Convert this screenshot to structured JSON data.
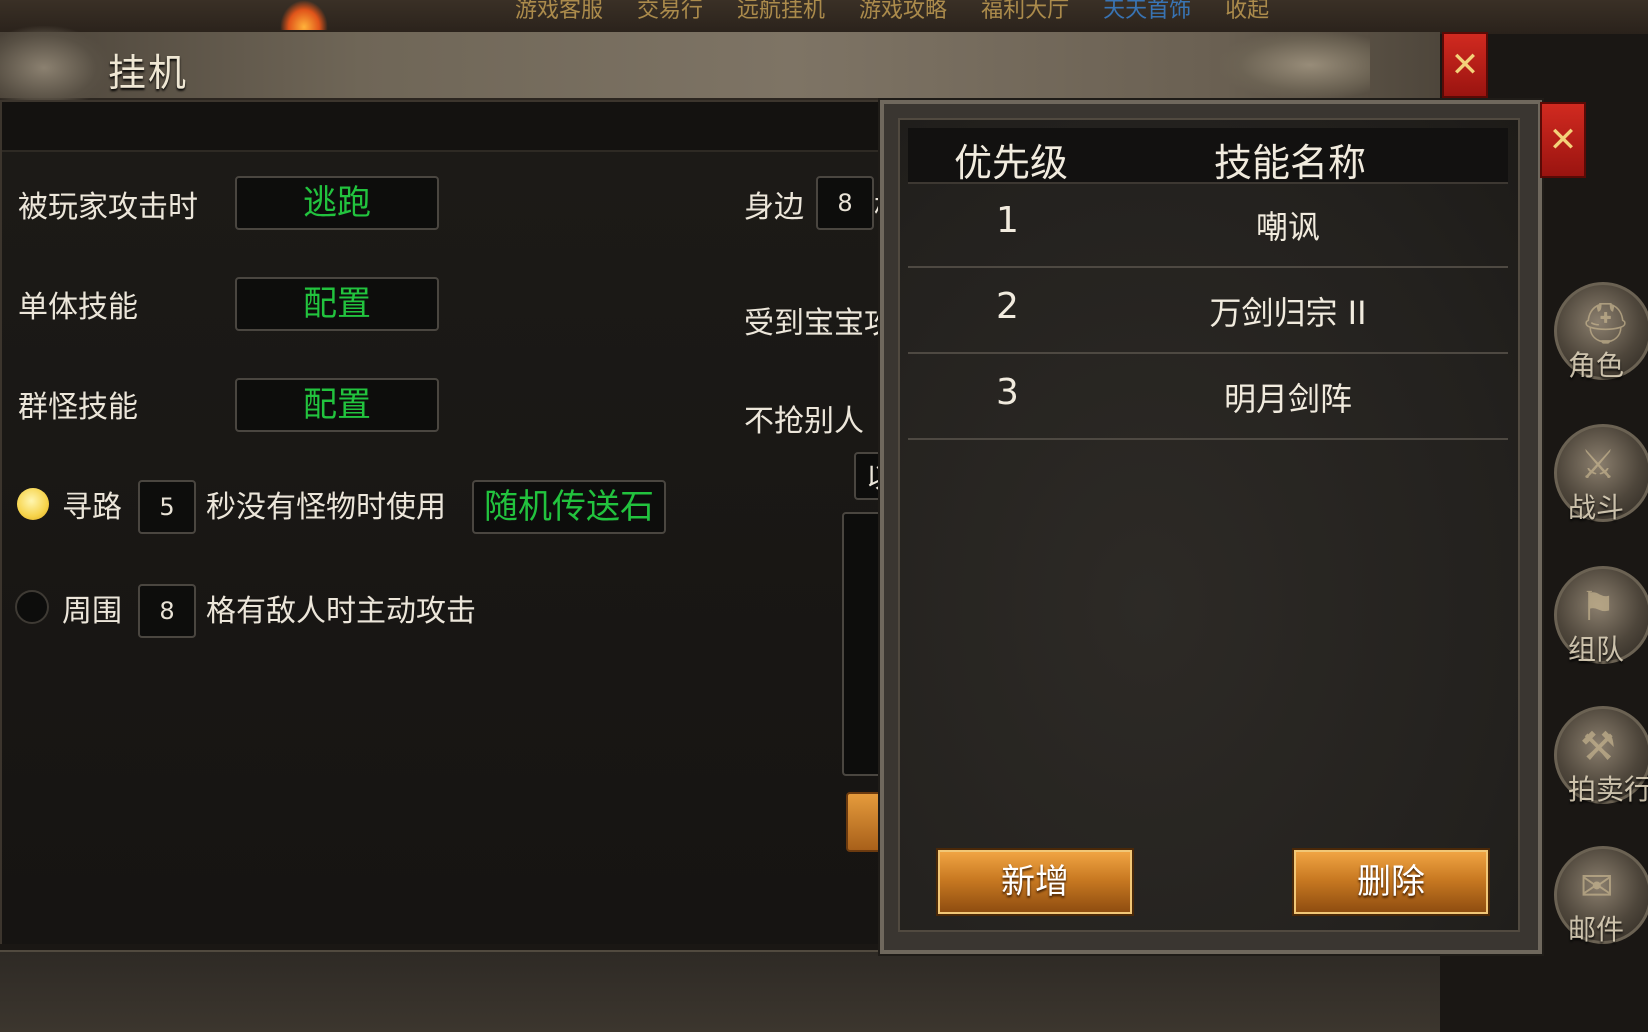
{
  "top_nav": {
    "items": [
      "游戏客服",
      "交易行",
      "远航挂机",
      "游戏攻略",
      "福利大厅",
      "天天首饰",
      "收起"
    ]
  },
  "window": {
    "title": "挂机"
  },
  "settings": {
    "attacked_by_player_label": "被玩家攻击时",
    "attacked_by_player_action": "逃跑",
    "single_skill_label": "单体技能",
    "single_skill_button": "配置",
    "group_skill_label": "群怪技能",
    "group_skill_button": "配置",
    "pathfind": {
      "selected": true,
      "label": "寻路",
      "seconds": "5",
      "suffix": "秒没有怪物时使用",
      "item_button": "随机传送石"
    },
    "surround": {
      "selected": false,
      "label": "周围",
      "cells": "8",
      "suffix": "格有敌人时主动攻击"
    },
    "right_column": {
      "nearby_label": "身边",
      "nearby_value": "8",
      "nearby_suffix_fragment": "格",
      "pet_attacked_label": "受到宝宝攻",
      "no_steal_label": "不抢别人",
      "clipped_input_fragment": "以"
    }
  },
  "skill_popup": {
    "columns": [
      "优先级",
      "技能名称"
    ],
    "rows": [
      {
        "priority": "1",
        "name": "嘲讽"
      },
      {
        "priority": "2",
        "name": "万剑归宗 II"
      },
      {
        "priority": "3",
        "name": "明月剑阵"
      }
    ],
    "add_button": "新增",
    "delete_button": "删除"
  },
  "side_menu": [
    {
      "label": "角色",
      "icon": "helmet-icon",
      "glyph": "⛑"
    },
    {
      "label": "战斗",
      "icon": "crossed-swords-icon",
      "glyph": "⚔"
    },
    {
      "label": "组队",
      "icon": "flag-icon",
      "glyph": "⚑"
    },
    {
      "label": "拍卖行",
      "icon": "gavel-icon",
      "glyph": "⚒"
    },
    {
      "label": "邮件",
      "icon": "mail-icon",
      "glyph": "✉"
    }
  ],
  "colors": {
    "accent_green": "#22c33e",
    "close_red": "#c4221a",
    "button_orange": "#c97a22",
    "radio_on": "#f6d34a"
  },
  "icons": {
    "close": "✕"
  }
}
